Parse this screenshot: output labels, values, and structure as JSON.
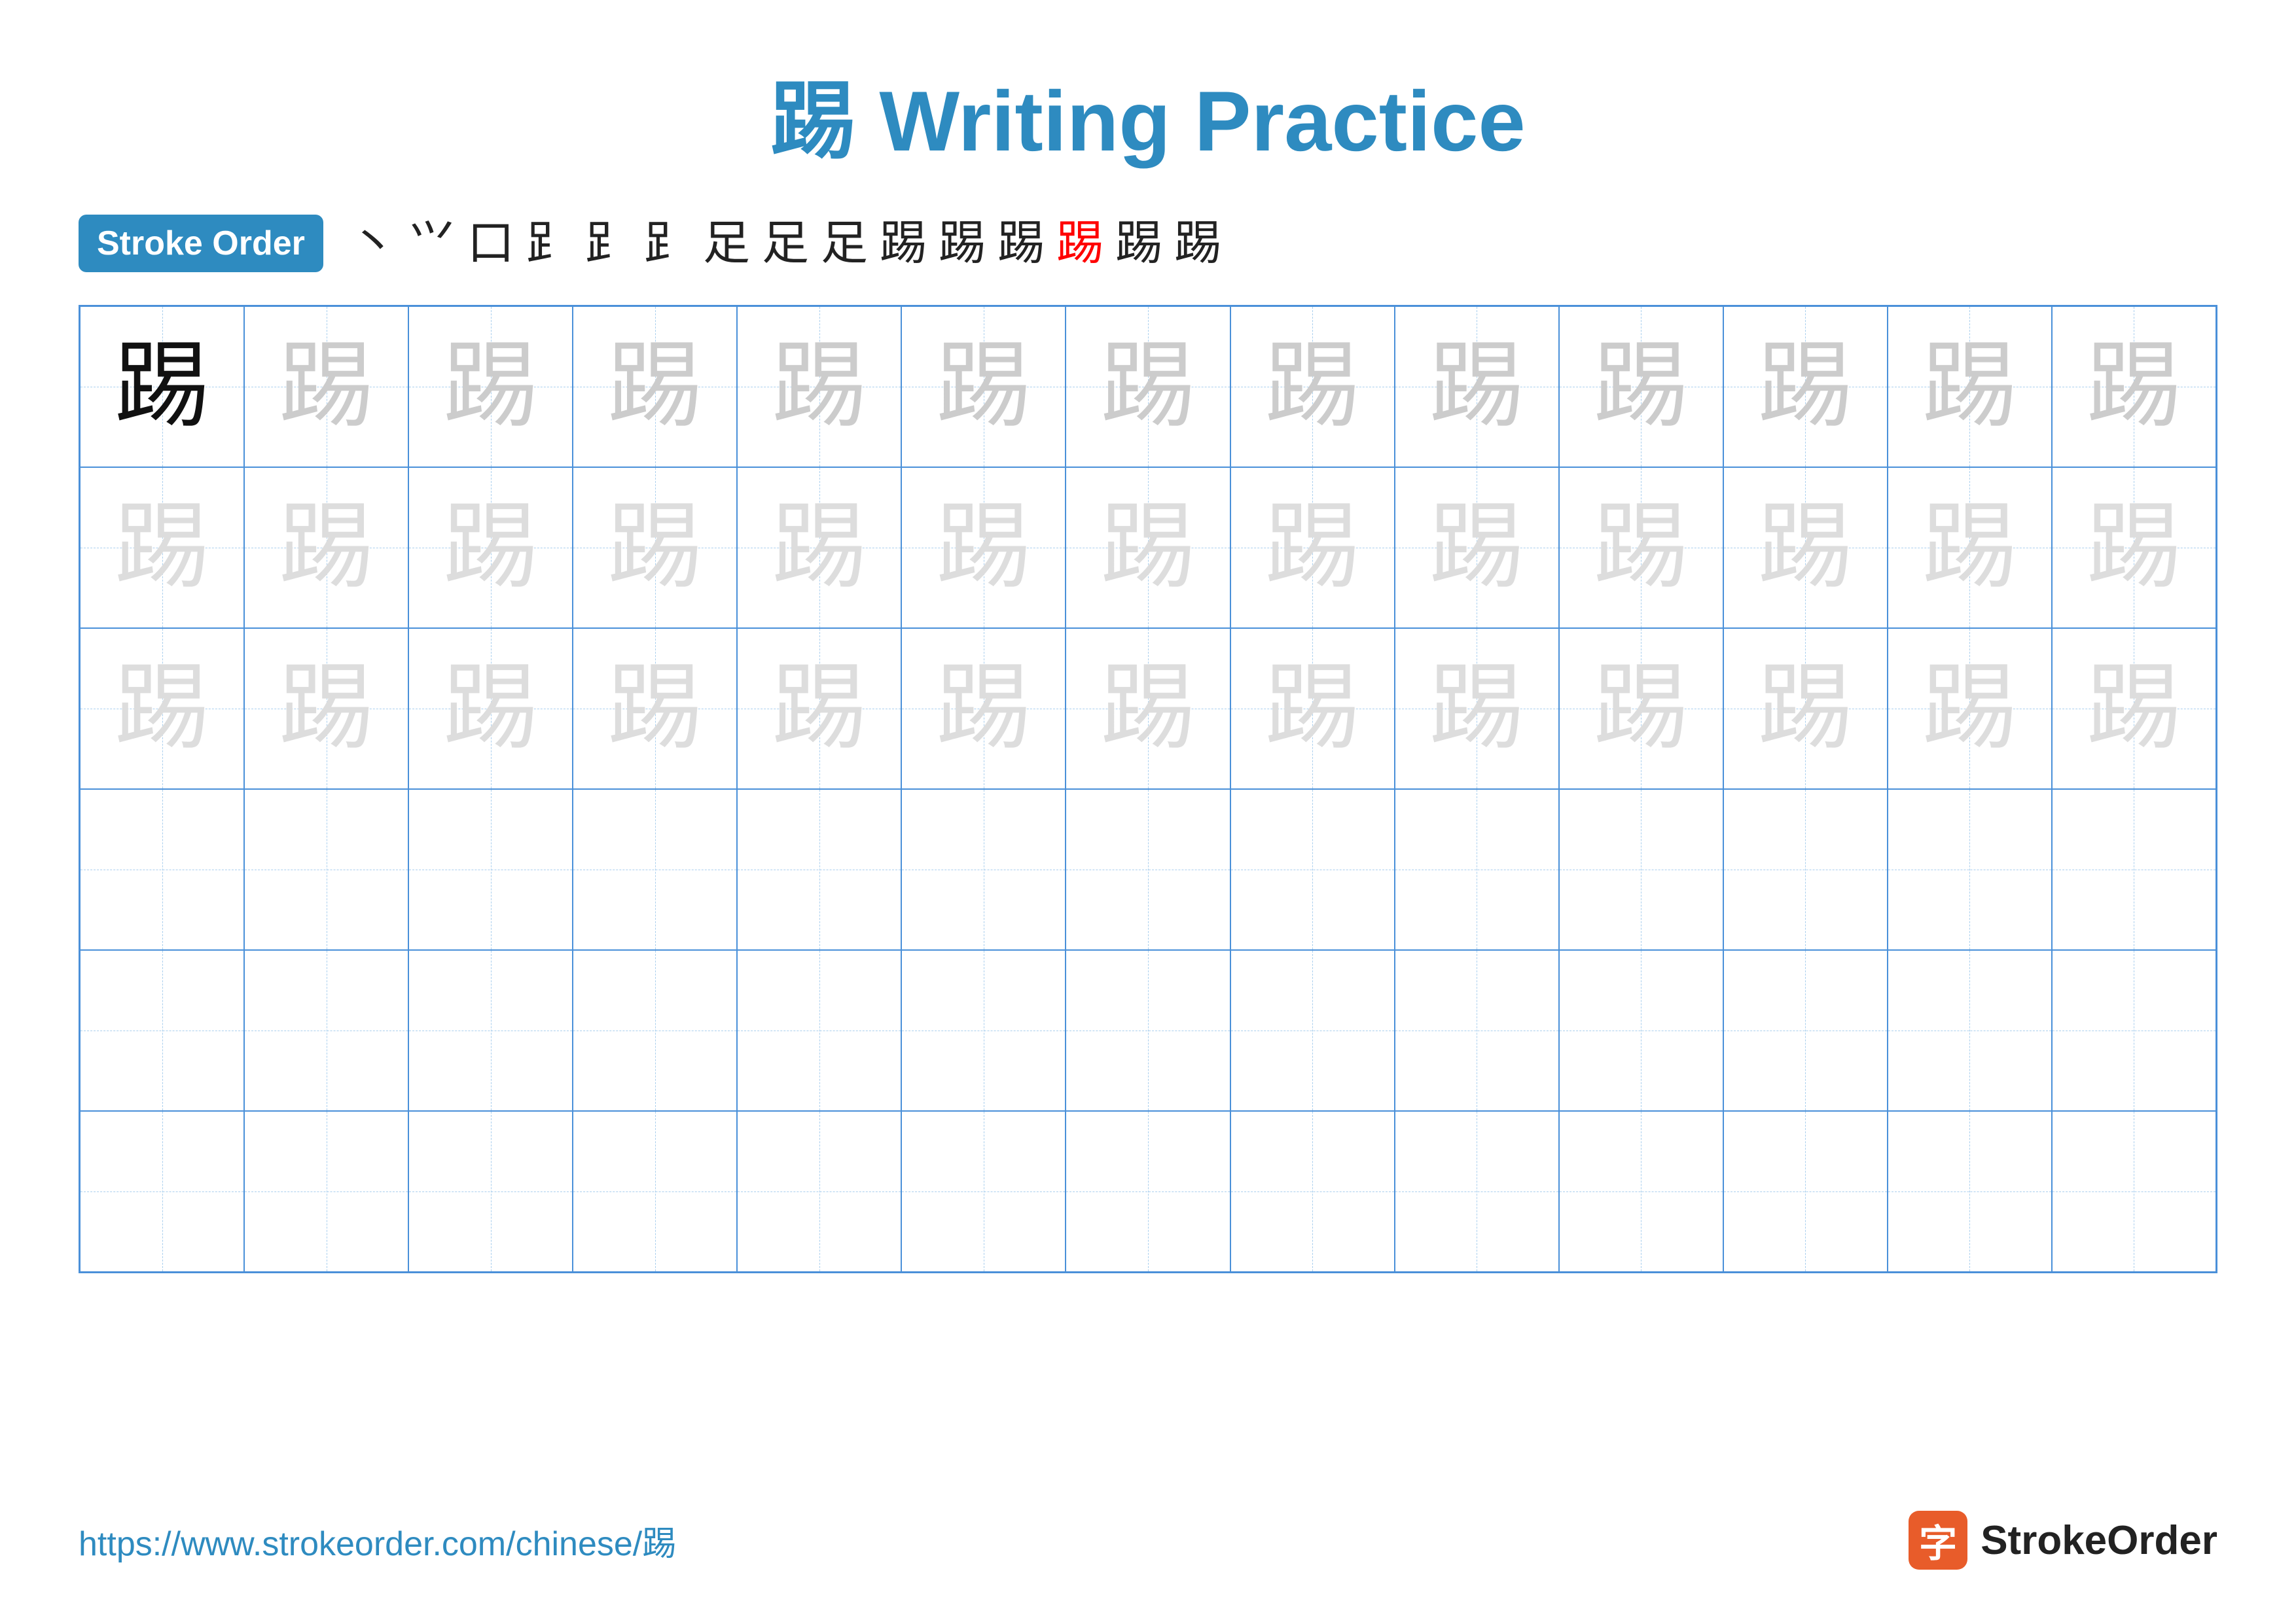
{
  "title": "踢 Writing Practice",
  "stroke_order_badge": "Stroke Order",
  "stroke_sequence": [
    "丶",
    "𠂉",
    "口",
    "𠂉",
    "𠂋",
    "𠂍",
    "足",
    "足'",
    "足⺊",
    "跑",
    "踢⁰",
    "踢¹",
    "踢²",
    "踢³",
    "踢"
  ],
  "character": "踢",
  "url": "https://www.strokeorder.com/chinese/踢",
  "logo_char": "字",
  "logo_name": "StrokeOrder",
  "rows": [
    {
      "cells": [
        {
          "char": "踢",
          "style": "dark"
        },
        {
          "char": "踢",
          "style": "medium"
        },
        {
          "char": "踢",
          "style": "medium"
        },
        {
          "char": "踢",
          "style": "medium"
        },
        {
          "char": "踢",
          "style": "medium"
        },
        {
          "char": "踢",
          "style": "medium"
        },
        {
          "char": "踢",
          "style": "medium"
        },
        {
          "char": "踢",
          "style": "medium"
        },
        {
          "char": "踢",
          "style": "medium"
        },
        {
          "char": "踢",
          "style": "medium"
        },
        {
          "char": "踢",
          "style": "medium"
        },
        {
          "char": "踢",
          "style": "medium"
        },
        {
          "char": "踢",
          "style": "medium"
        }
      ]
    },
    {
      "cells": [
        {
          "char": "踢",
          "style": "light"
        },
        {
          "char": "踢",
          "style": "light"
        },
        {
          "char": "踢",
          "style": "light"
        },
        {
          "char": "踢",
          "style": "light"
        },
        {
          "char": "踢",
          "style": "light"
        },
        {
          "char": "踢",
          "style": "light"
        },
        {
          "char": "踢",
          "style": "light"
        },
        {
          "char": "踢",
          "style": "light"
        },
        {
          "char": "踢",
          "style": "light"
        },
        {
          "char": "踢",
          "style": "light"
        },
        {
          "char": "踢",
          "style": "light"
        },
        {
          "char": "踢",
          "style": "light"
        },
        {
          "char": "踢",
          "style": "light"
        }
      ]
    },
    {
      "cells": [
        {
          "char": "踢",
          "style": "light"
        },
        {
          "char": "踢",
          "style": "light"
        },
        {
          "char": "踢",
          "style": "light"
        },
        {
          "char": "踢",
          "style": "light"
        },
        {
          "char": "踢",
          "style": "light"
        },
        {
          "char": "踢",
          "style": "light"
        },
        {
          "char": "踢",
          "style": "light"
        },
        {
          "char": "踢",
          "style": "light"
        },
        {
          "char": "踢",
          "style": "light"
        },
        {
          "char": "踢",
          "style": "light"
        },
        {
          "char": "踢",
          "style": "light"
        },
        {
          "char": "踢",
          "style": "light"
        },
        {
          "char": "踢",
          "style": "light"
        }
      ]
    },
    {
      "cells": [
        {
          "char": "",
          "style": "empty"
        },
        {
          "char": "",
          "style": "empty"
        },
        {
          "char": "",
          "style": "empty"
        },
        {
          "char": "",
          "style": "empty"
        },
        {
          "char": "",
          "style": "empty"
        },
        {
          "char": "",
          "style": "empty"
        },
        {
          "char": "",
          "style": "empty"
        },
        {
          "char": "",
          "style": "empty"
        },
        {
          "char": "",
          "style": "empty"
        },
        {
          "char": "",
          "style": "empty"
        },
        {
          "char": "",
          "style": "empty"
        },
        {
          "char": "",
          "style": "empty"
        },
        {
          "char": "",
          "style": "empty"
        }
      ]
    },
    {
      "cells": [
        {
          "char": "",
          "style": "empty"
        },
        {
          "char": "",
          "style": "empty"
        },
        {
          "char": "",
          "style": "empty"
        },
        {
          "char": "",
          "style": "empty"
        },
        {
          "char": "",
          "style": "empty"
        },
        {
          "char": "",
          "style": "empty"
        },
        {
          "char": "",
          "style": "empty"
        },
        {
          "char": "",
          "style": "empty"
        },
        {
          "char": "",
          "style": "empty"
        },
        {
          "char": "",
          "style": "empty"
        },
        {
          "char": "",
          "style": "empty"
        },
        {
          "char": "",
          "style": "empty"
        },
        {
          "char": "",
          "style": "empty"
        }
      ]
    },
    {
      "cells": [
        {
          "char": "",
          "style": "empty"
        },
        {
          "char": "",
          "style": "empty"
        },
        {
          "char": "",
          "style": "empty"
        },
        {
          "char": "",
          "style": "empty"
        },
        {
          "char": "",
          "style": "empty"
        },
        {
          "char": "",
          "style": "empty"
        },
        {
          "char": "",
          "style": "empty"
        },
        {
          "char": "",
          "style": "empty"
        },
        {
          "char": "",
          "style": "empty"
        },
        {
          "char": "",
          "style": "empty"
        },
        {
          "char": "",
          "style": "empty"
        },
        {
          "char": "",
          "style": "empty"
        },
        {
          "char": "",
          "style": "empty"
        }
      ]
    }
  ]
}
